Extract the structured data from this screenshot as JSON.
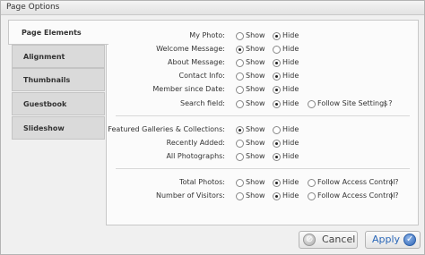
{
  "window": {
    "title": "Page Options"
  },
  "tabs": [
    {
      "label": "Page Elements",
      "active": true
    },
    {
      "label": "Alignment",
      "active": false
    },
    {
      "label": "Thumbnails",
      "active": false
    },
    {
      "label": "Guestbook",
      "active": false
    },
    {
      "label": "Slideshow",
      "active": false
    }
  ],
  "options": {
    "show": "Show",
    "hide": "Hide",
    "follow_site": "Follow Site Settings",
    "follow_access": "Follow Access Control",
    "help": "| ?"
  },
  "rows": {
    "my_photo": {
      "label": "My Photo:",
      "selected": "Hide"
    },
    "welcome_message": {
      "label": "Welcome Message:",
      "selected": "Show"
    },
    "about_message": {
      "label": "About Message:",
      "selected": "Hide"
    },
    "contact_info": {
      "label": "Contact Info:",
      "selected": "Hide"
    },
    "member_since": {
      "label": "Member since Date:",
      "selected": "Hide"
    },
    "search_field": {
      "label": "Search field:",
      "selected": "Hide"
    },
    "featured": {
      "label": "Featured Galleries & Collections:",
      "selected": "Show"
    },
    "recently_added": {
      "label": "Recently Added:",
      "selected": "Hide"
    },
    "all_photographs": {
      "label": "All Photographs:",
      "selected": "Hide"
    },
    "total_photos": {
      "label": "Total Photos:",
      "selected": "Hide"
    },
    "number_of_visitors": {
      "label": "Number of Visitors:",
      "selected": "Hide"
    }
  },
  "buttons": {
    "cancel": "Cancel",
    "apply": "Apply"
  },
  "colors": {
    "apply_text": "#2a67b8",
    "panel_bg": "#fbfbfb",
    "tab_bg": "#dadada"
  }
}
